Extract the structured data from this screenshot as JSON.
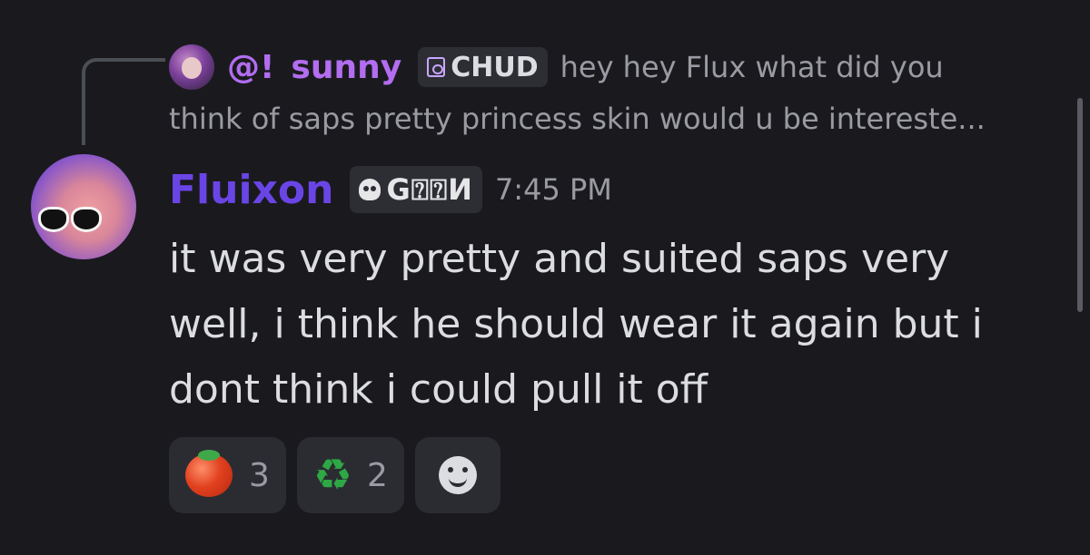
{
  "reply": {
    "mention": "@!",
    "author": "sunny",
    "tag": "CHUD",
    "text_line1": "hey hey Flux what did you",
    "text_line2": "think of saps pretty princess skin would u be intereste..."
  },
  "message": {
    "author": "Fluixon",
    "tag": "G⍰⍰И",
    "timestamp": "7:45 PM",
    "text": "it was very pretty and suited saps very well, i think he should wear it again but i dont think i could pull it off"
  },
  "reactions": [
    {
      "emoji": "tomato",
      "count": "3"
    },
    {
      "emoji": "recycle",
      "count": "2"
    }
  ],
  "colors": {
    "reply_author": "#b26df0",
    "author": "#6a45e6",
    "background": "#1a1a1e"
  }
}
